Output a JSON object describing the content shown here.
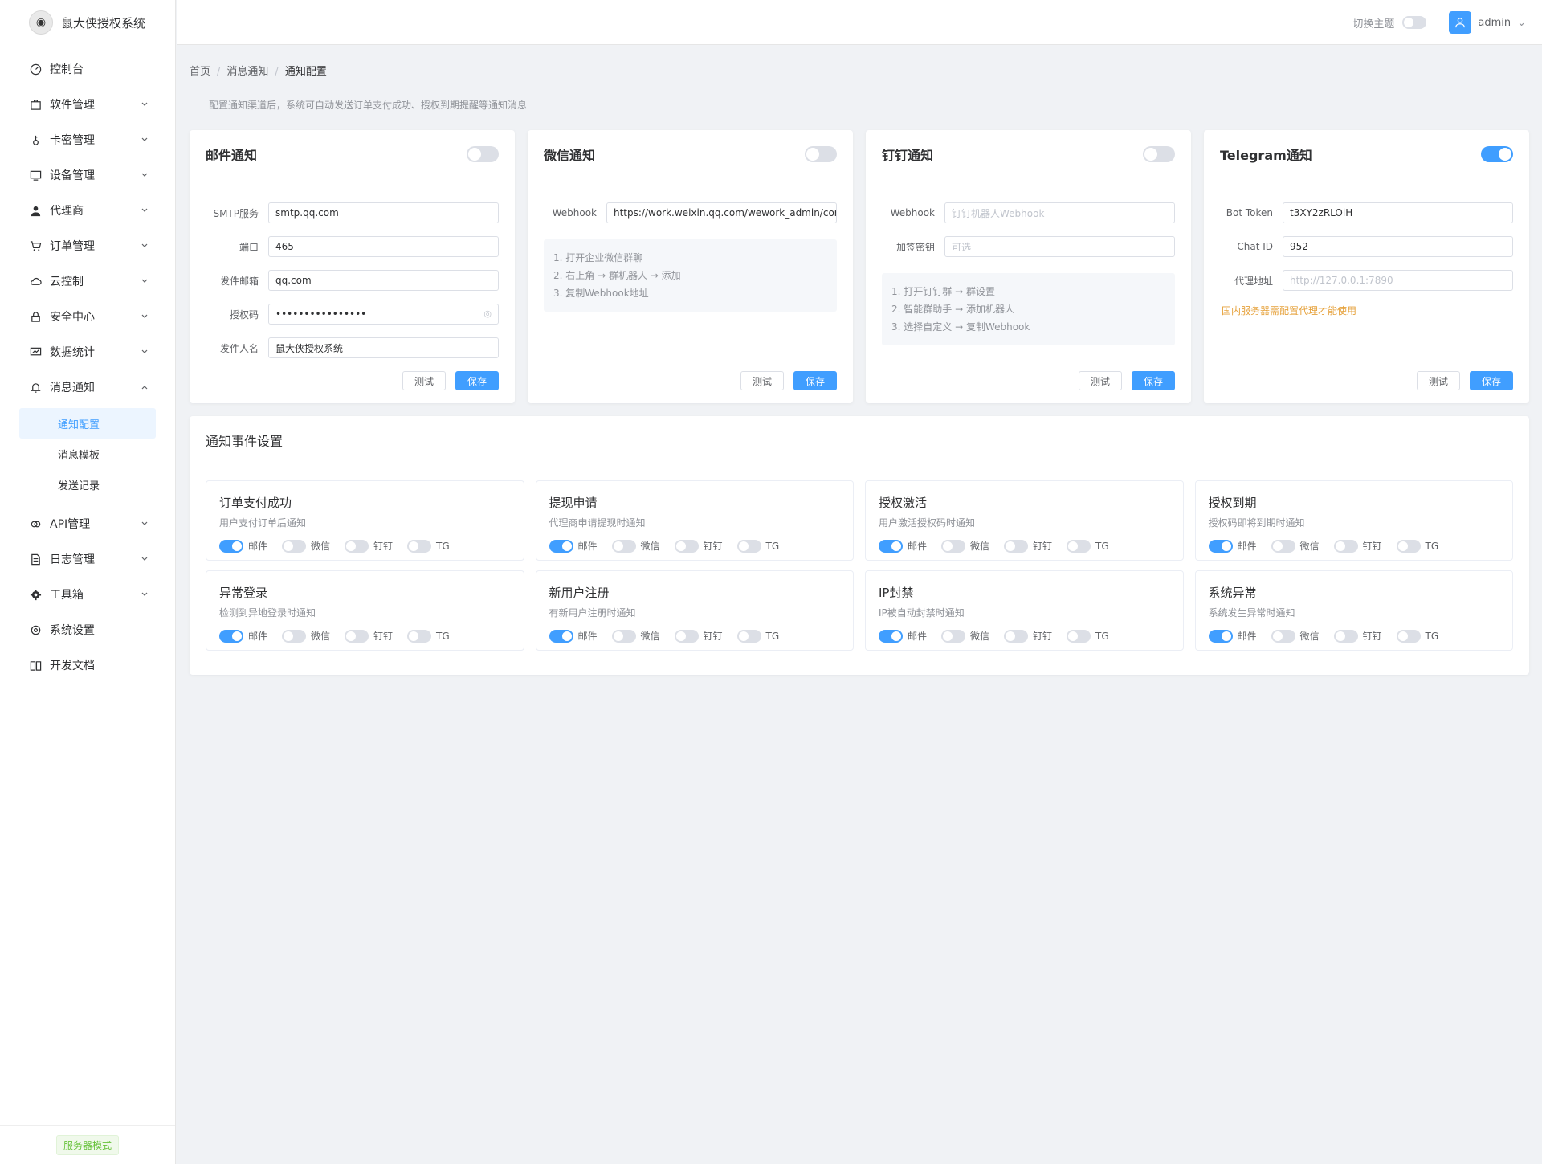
{
  "app": {
    "title": "鼠大侠授权系统"
  },
  "sidebar": {
    "items": [
      {
        "label": "控制台",
        "icon": "dashboard-icon",
        "expandable": false
      },
      {
        "label": "软件管理",
        "icon": "package-icon",
        "expandable": true
      },
      {
        "label": "卡密管理",
        "icon": "key-icon",
        "expandable": true
      },
      {
        "label": "设备管理",
        "icon": "monitor-icon",
        "expandable": true
      },
      {
        "label": "代理商",
        "icon": "user-icon",
        "expandable": true
      },
      {
        "label": "订单管理",
        "icon": "cart-icon",
        "expandable": true
      },
      {
        "label": "云控制",
        "icon": "cloud-icon",
        "expandable": true
      },
      {
        "label": "安全中心",
        "icon": "lock-icon",
        "expandable": true
      },
      {
        "label": "数据统计",
        "icon": "chart-icon",
        "expandable": true
      },
      {
        "label": "消息通知",
        "icon": "bell-icon",
        "expandable": true,
        "expanded": true
      }
    ],
    "sub_items": [
      {
        "label": "通知配置",
        "active": true
      },
      {
        "label": "消息模板",
        "active": false
      },
      {
        "label": "发送记录",
        "active": false
      }
    ],
    "items_after": [
      {
        "label": "API管理",
        "icon": "link-icon",
        "expandable": true
      },
      {
        "label": "日志管理",
        "icon": "document-icon",
        "expandable": true
      },
      {
        "label": "工具箱",
        "icon": "gear-solid-icon",
        "expandable": true
      },
      {
        "label": "系统设置",
        "icon": "settings-icon",
        "expandable": false
      },
      {
        "label": "开发文档",
        "icon": "book-icon",
        "expandable": false
      }
    ],
    "footer_badge": "服务器模式"
  },
  "header": {
    "theme_label": "切换主题",
    "theme_on": false,
    "user_name": "admin"
  },
  "breadcrumb": [
    "首页",
    "消息通知",
    "通知配置"
  ],
  "description": "配置通知渠道后，系统可自动发送订单支付成功、授权到期提醒等通知消息",
  "channels": [
    {
      "title": "邮件通知",
      "enabled": false,
      "fields": [
        {
          "label": "SMTP服务",
          "value": "smtp.qq.com",
          "placeholder": false
        },
        {
          "label": "端口",
          "value": "465",
          "placeholder": false
        },
        {
          "label": "发件邮箱",
          "value": "qq.com",
          "placeholder": false
        },
        {
          "label": "授权码",
          "value": "••••••••••••••••",
          "placeholder": false,
          "password": true
        },
        {
          "label": "发件人名",
          "value": "鼠大侠授权系统",
          "placeholder": false
        }
      ],
      "hint": [],
      "warn": "",
      "test_label": "测试",
      "save_label": "保存"
    },
    {
      "title": "微信通知",
      "enabled": false,
      "fields": [
        {
          "label": "Webhook",
          "value": "https://work.weixin.qq.com/wework_admin/common/c",
          "placeholder": false
        }
      ],
      "hint": [
        "1. 打开企业微信群聊",
        "2. 右上角 → 群机器人 → 添加",
        "3. 复制Webhook地址"
      ],
      "warn": "",
      "test_label": "测试",
      "save_label": "保存"
    },
    {
      "title": "钉钉通知",
      "enabled": false,
      "fields": [
        {
          "label": "Webhook",
          "value": "钉钉机器人Webhook",
          "placeholder": true
        },
        {
          "label": "加签密钥",
          "value": "可选",
          "placeholder": true
        }
      ],
      "hint": [
        "1. 打开钉钉群 → 群设置",
        "2. 智能群助手 → 添加机器人",
        "3. 选择自定义 → 复制Webhook"
      ],
      "warn": "",
      "test_label": "测试",
      "save_label": "保存"
    },
    {
      "title": "Telegram通知",
      "enabled": true,
      "fields": [
        {
          "label": "Bot Token",
          "value": "t3XY2zRLOiH",
          "placeholder": false
        },
        {
          "label": "Chat ID",
          "value": "952",
          "placeholder": false
        },
        {
          "label": "代理地址",
          "value": "http://127.0.0.1:7890",
          "placeholder": true
        }
      ],
      "hint": [],
      "warn": "国内服务器需配置代理才能使用",
      "test_label": "测试",
      "save_label": "保存"
    }
  ],
  "events": {
    "title": "通知事件设置",
    "channel_labels": [
      "邮件",
      "微信",
      "钉钉",
      "TG"
    ],
    "items": [
      {
        "title": "订单支付成功",
        "desc": "用户支付订单后通知",
        "toggles": [
          true,
          false,
          false,
          false
        ]
      },
      {
        "title": "提现申请",
        "desc": "代理商申请提现时通知",
        "toggles": [
          true,
          false,
          false,
          false
        ]
      },
      {
        "title": "授权激活",
        "desc": "用户激活授权码时通知",
        "toggles": [
          true,
          false,
          false,
          false
        ]
      },
      {
        "title": "授权到期",
        "desc": "授权码即将到期时通知",
        "toggles": [
          true,
          false,
          false,
          false
        ]
      },
      {
        "title": "异常登录",
        "desc": "检测到异地登录时通知",
        "toggles": [
          true,
          false,
          false,
          false
        ]
      },
      {
        "title": "新用户注册",
        "desc": "有新用户注册时通知",
        "toggles": [
          true,
          false,
          false,
          false
        ]
      },
      {
        "title": "IP封禁",
        "desc": "IP被自动封禁时通知",
        "toggles": [
          true,
          false,
          false,
          false
        ]
      },
      {
        "title": "系统异常",
        "desc": "系统发生异常时通知",
        "toggles": [
          true,
          false,
          false,
          false
        ]
      }
    ]
  }
}
